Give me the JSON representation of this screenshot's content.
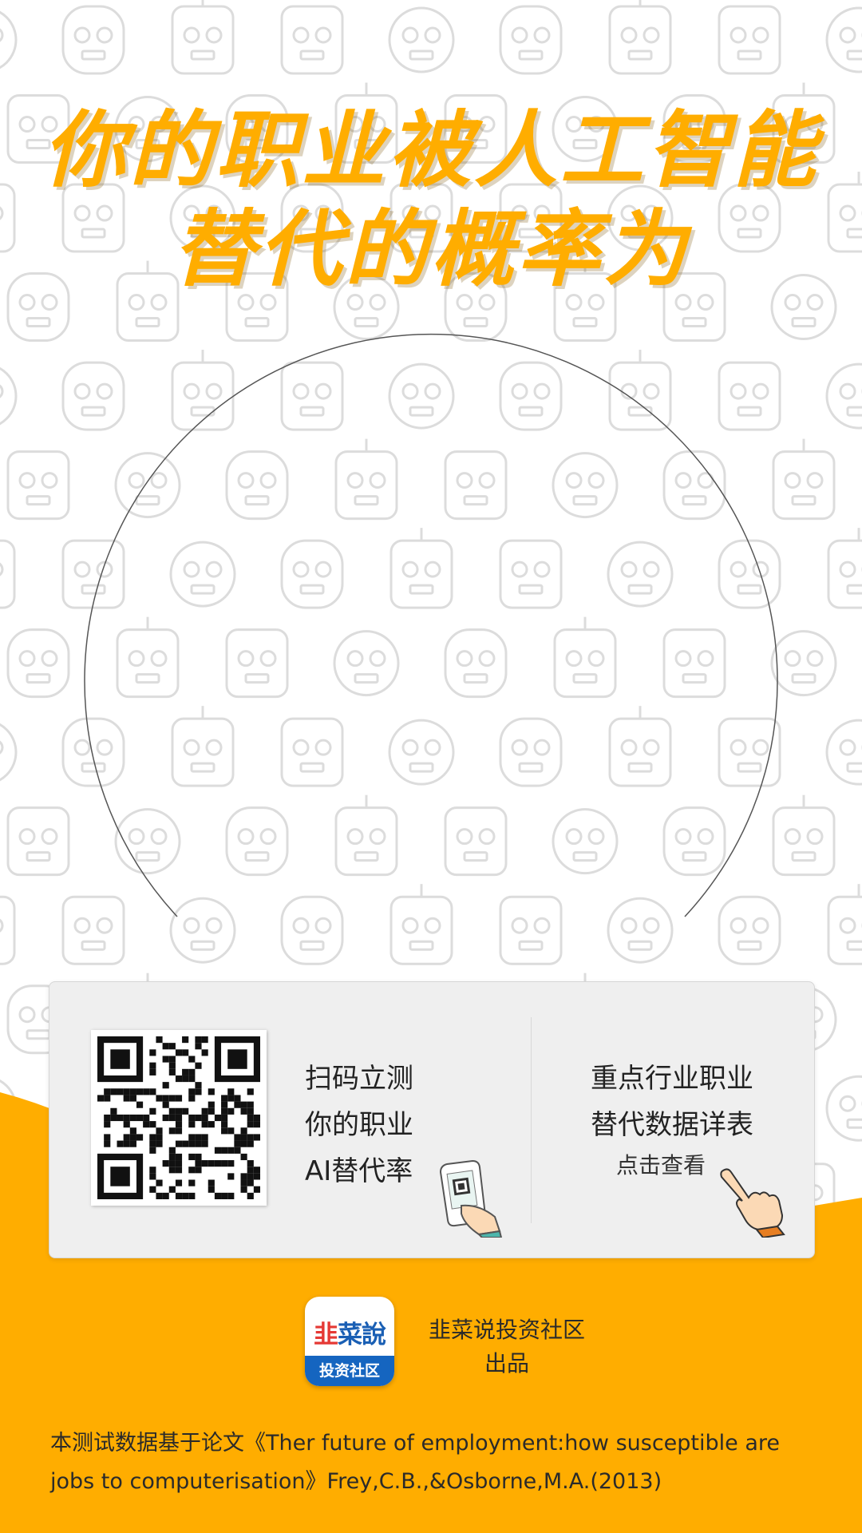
{
  "title": {
    "line1": "你的职业被人工智能",
    "line2": "替代的概率为"
  },
  "card": {
    "scan_lines": [
      "扫码立测",
      "你的职业",
      "AI替代率"
    ],
    "right_lines": [
      "重点行业职业",
      "替代数据详表"
    ],
    "click_label": "点击查看"
  },
  "brand": {
    "logo_top_red": "韭",
    "logo_top_blue": "菜說",
    "logo_bottom": "投资社区",
    "name": "韭菜说投资社区",
    "produced": "出品"
  },
  "footnote": "本测试数据基于论文《Ther future of employment:how susceptible are jobs to computerisation》Frey,C.B.,&Osborne,M.A.(2013)",
  "colors": {
    "accent": "#ffad00",
    "card_bg": "#efefef",
    "pattern": "#dcdcdc"
  },
  "icons": {
    "background": "robot-face-pattern",
    "qr": "qr-code",
    "phone": "phone-scan-icon",
    "hand": "pointing-hand-icon"
  }
}
